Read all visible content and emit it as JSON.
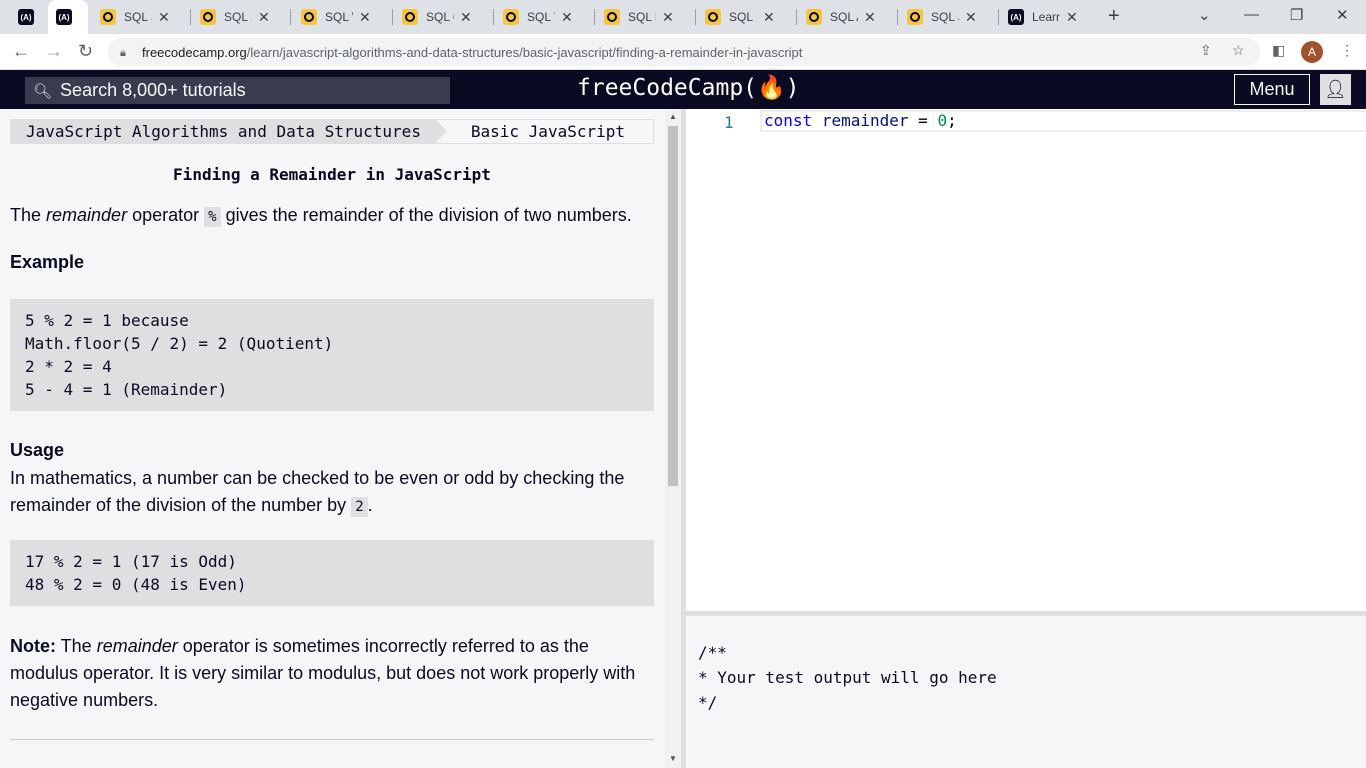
{
  "browser": {
    "tabs": [
      {
        "label": "",
        "favicon": "fcc"
      },
      {
        "label": "",
        "favicon": "fcc"
      },
      {
        "label": "SQL Sy",
        "favicon": "w3"
      },
      {
        "label": "SQL Se",
        "favicon": "w3"
      },
      {
        "label": "SQL W",
        "favicon": "w3"
      },
      {
        "label": "SQL O",
        "favicon": "w3"
      },
      {
        "label": "SQL To",
        "favicon": "w3"
      },
      {
        "label": "SQL D",
        "favicon": "w3"
      },
      {
        "label": "SQL In",
        "favicon": "w3"
      },
      {
        "label": "SQL A",
        "favicon": "w3"
      },
      {
        "label": "SQL Jo",
        "favicon": "w3"
      },
      {
        "label": "Learn t",
        "favicon": "fcc"
      }
    ],
    "url_host": "freecodecamp.org",
    "url_path": "/learn/javascript-algorithms-and-data-structures/basic-javascript/finding-a-remainder-in-javascript",
    "profile_initial": "A"
  },
  "navbar": {
    "search_placeholder": "Search 8,000+ tutorials",
    "logo": "freeCodeCamp(🔥)",
    "menu_label": "Menu"
  },
  "breadcrumb": {
    "course": "JavaScript Algorithms and Data Structures",
    "section": "Basic JavaScript"
  },
  "challenge": {
    "title": "Finding a Remainder in JavaScript",
    "intro": {
      "pre": "The ",
      "em": "remainder",
      "mid": " operator ",
      "code": "%",
      "post": " gives the remainder of the division of two numbers."
    },
    "example_heading": "Example",
    "example_code": "5 % 2 = 1 because\nMath.floor(5 / 2) = 2 (Quotient)\n2 * 2 = 4\n5 - 4 = 1 (Remainder)",
    "usage_heading": "Usage",
    "usage": {
      "pre": "In mathematics, a number can be checked to be even or odd by checking the remainder of the division of the number by ",
      "code": "2",
      "post": "."
    },
    "usage_code": "17 % 2 = 1 (17 is Odd)\n48 % 2 = 0 (48 is Even)",
    "note": {
      "label": "Note:",
      "pre": " The ",
      "em": "remainder",
      "post": " operator is sometimes incorrectly referred to as the modulus operator. It is very similar to modulus, but does not work properly with negative numbers."
    }
  },
  "editor": {
    "line_number": "1",
    "tokens": {
      "kw": "const",
      "id": "remainder",
      "op": "=",
      "num": "0",
      "end": ";"
    }
  },
  "output": {
    "text": "/**\n* Your test output will go here\n*/"
  },
  "colors": {
    "nav_bg": "#0a0a23",
    "panel_bg": "#f5f6f7",
    "code_bg": "#dfdfe2",
    "keyword": "#0000ff",
    "number": "#098658"
  }
}
